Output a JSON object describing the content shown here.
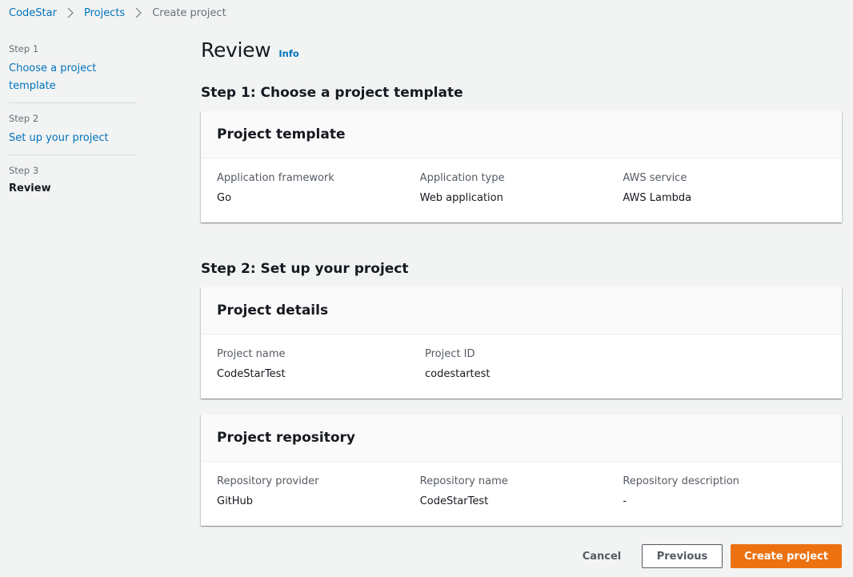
{
  "breadcrumb": {
    "items": [
      {
        "label": "CodeStar"
      },
      {
        "label": "Projects"
      },
      {
        "label": "Create project"
      }
    ]
  },
  "sidenav": {
    "steps": [
      {
        "step": "Step 1",
        "title": "Choose a project template"
      },
      {
        "step": "Step 2",
        "title": "Set up your project"
      },
      {
        "step": "Step 3",
        "title": "Review"
      }
    ]
  },
  "page": {
    "title": "Review",
    "info_link": "Info"
  },
  "section1": {
    "title": "Step 1: Choose a project template",
    "card": {
      "title": "Project template",
      "fields": [
        {
          "key": "Application framework",
          "value": "Go"
        },
        {
          "key": "Application type",
          "value": "Web application"
        },
        {
          "key": "AWS service",
          "value": "AWS Lambda"
        }
      ]
    }
  },
  "section2": {
    "title": "Step 2: Set up your project",
    "details_card": {
      "title": "Project details",
      "fields": [
        {
          "key": "Project name",
          "value": "CodeStarTest"
        },
        {
          "key": "Project ID",
          "value": "codestartest"
        }
      ]
    },
    "repo_card": {
      "title": "Project repository",
      "fields": [
        {
          "key": "Repository provider",
          "value": "GitHub"
        },
        {
          "key": "Repository name",
          "value": "CodeStarTest"
        },
        {
          "key": "Repository description",
          "value": "-"
        }
      ]
    }
  },
  "actions": {
    "cancel": "Cancel",
    "previous": "Previous",
    "create": "Create project"
  },
  "colors": {
    "link": "#0073bb",
    "primary": "#ec7211",
    "background": "#f2f3f3"
  },
  "icons": {
    "breadcrumb_separator": "chevron-right-icon"
  }
}
